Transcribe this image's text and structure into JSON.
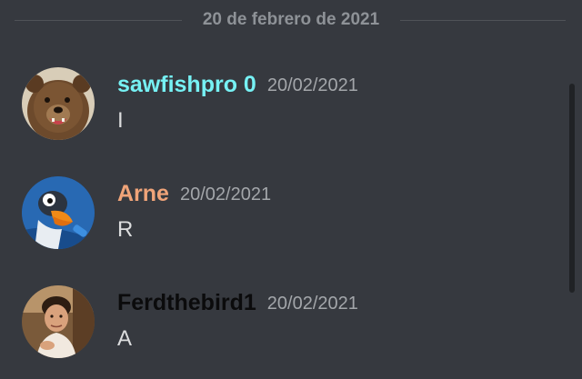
{
  "date_divider": "20 de febrero de 2021",
  "messages": [
    {
      "username": "sawfishpro 0",
      "username_color": "#76f1f4",
      "timestamp": "20/02/2021",
      "content": "I",
      "avatar_icon": "bear-avatar"
    },
    {
      "username": "Arne",
      "username_color": "#f0a479",
      "timestamp": "20/02/2021",
      "content": "R",
      "avatar_icon": "penguin-avatar"
    },
    {
      "username": "Ferdthebird1",
      "username_color": "#0b0b0c",
      "timestamp": "20/02/2021",
      "content": "A",
      "avatar_icon": "person-avatar"
    }
  ],
  "colors": {
    "background": "#36393f",
    "divider_text": "#8e9297",
    "timestamp": "#a3a6aa",
    "message_text": "#dcddde"
  }
}
